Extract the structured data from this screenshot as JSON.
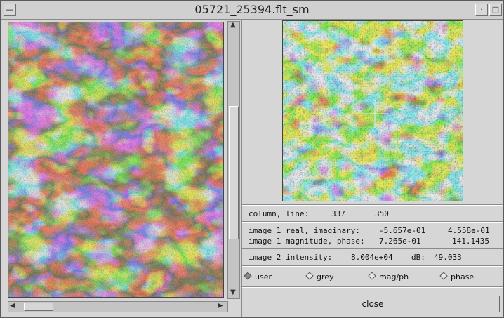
{
  "window": {
    "title": "05721_25394.flt_sm"
  },
  "info": {
    "column_line_label": "column, line:",
    "column": "337",
    "line": "350",
    "real_imag_label": "image 1 real, imaginary:",
    "real": "-5.657e-01",
    "imag": "4.558e-01",
    "mag_phase_label": "image 1 magnitude, phase:",
    "magnitude": "7.265e-01",
    "phase": "141.1435",
    "intensity_label": "image 2 intensity:",
    "intensity": "8.004e+04",
    "db_label": "dB:",
    "db": "49.033"
  },
  "modes": [
    {
      "label": "user",
      "selected": true
    },
    {
      "label": "grey",
      "selected": false
    },
    {
      "label": "mag/ph",
      "selected": false
    },
    {
      "label": "phase",
      "selected": false
    }
  ],
  "buttons": {
    "close": "close"
  },
  "colors": {
    "magenta": "#e03ad8",
    "yellow": "#e6d81a",
    "cyan": "#2fd8e8",
    "dark": "#2a3a22"
  }
}
